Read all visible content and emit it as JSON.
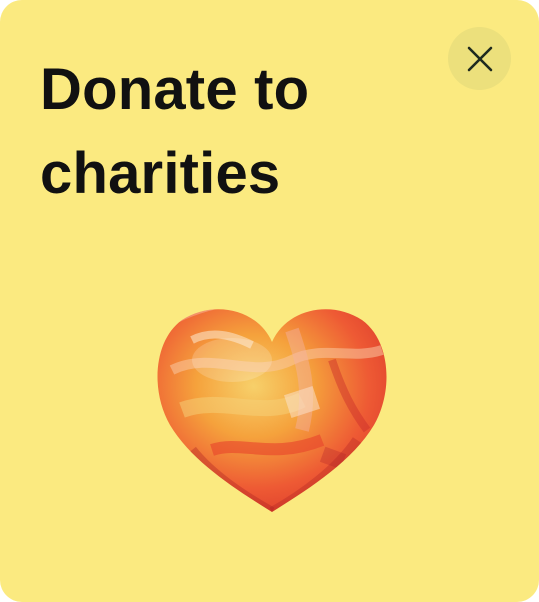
{
  "card": {
    "title": "Donate to charities",
    "background_color": "#fbea80"
  },
  "close_button": {
    "icon": "close-icon",
    "background_color": "#ece07c"
  },
  "illustration": {
    "icon": "heart-icon",
    "colors": [
      "#ee4d33",
      "#f5a23c",
      "#f7d06a"
    ]
  }
}
